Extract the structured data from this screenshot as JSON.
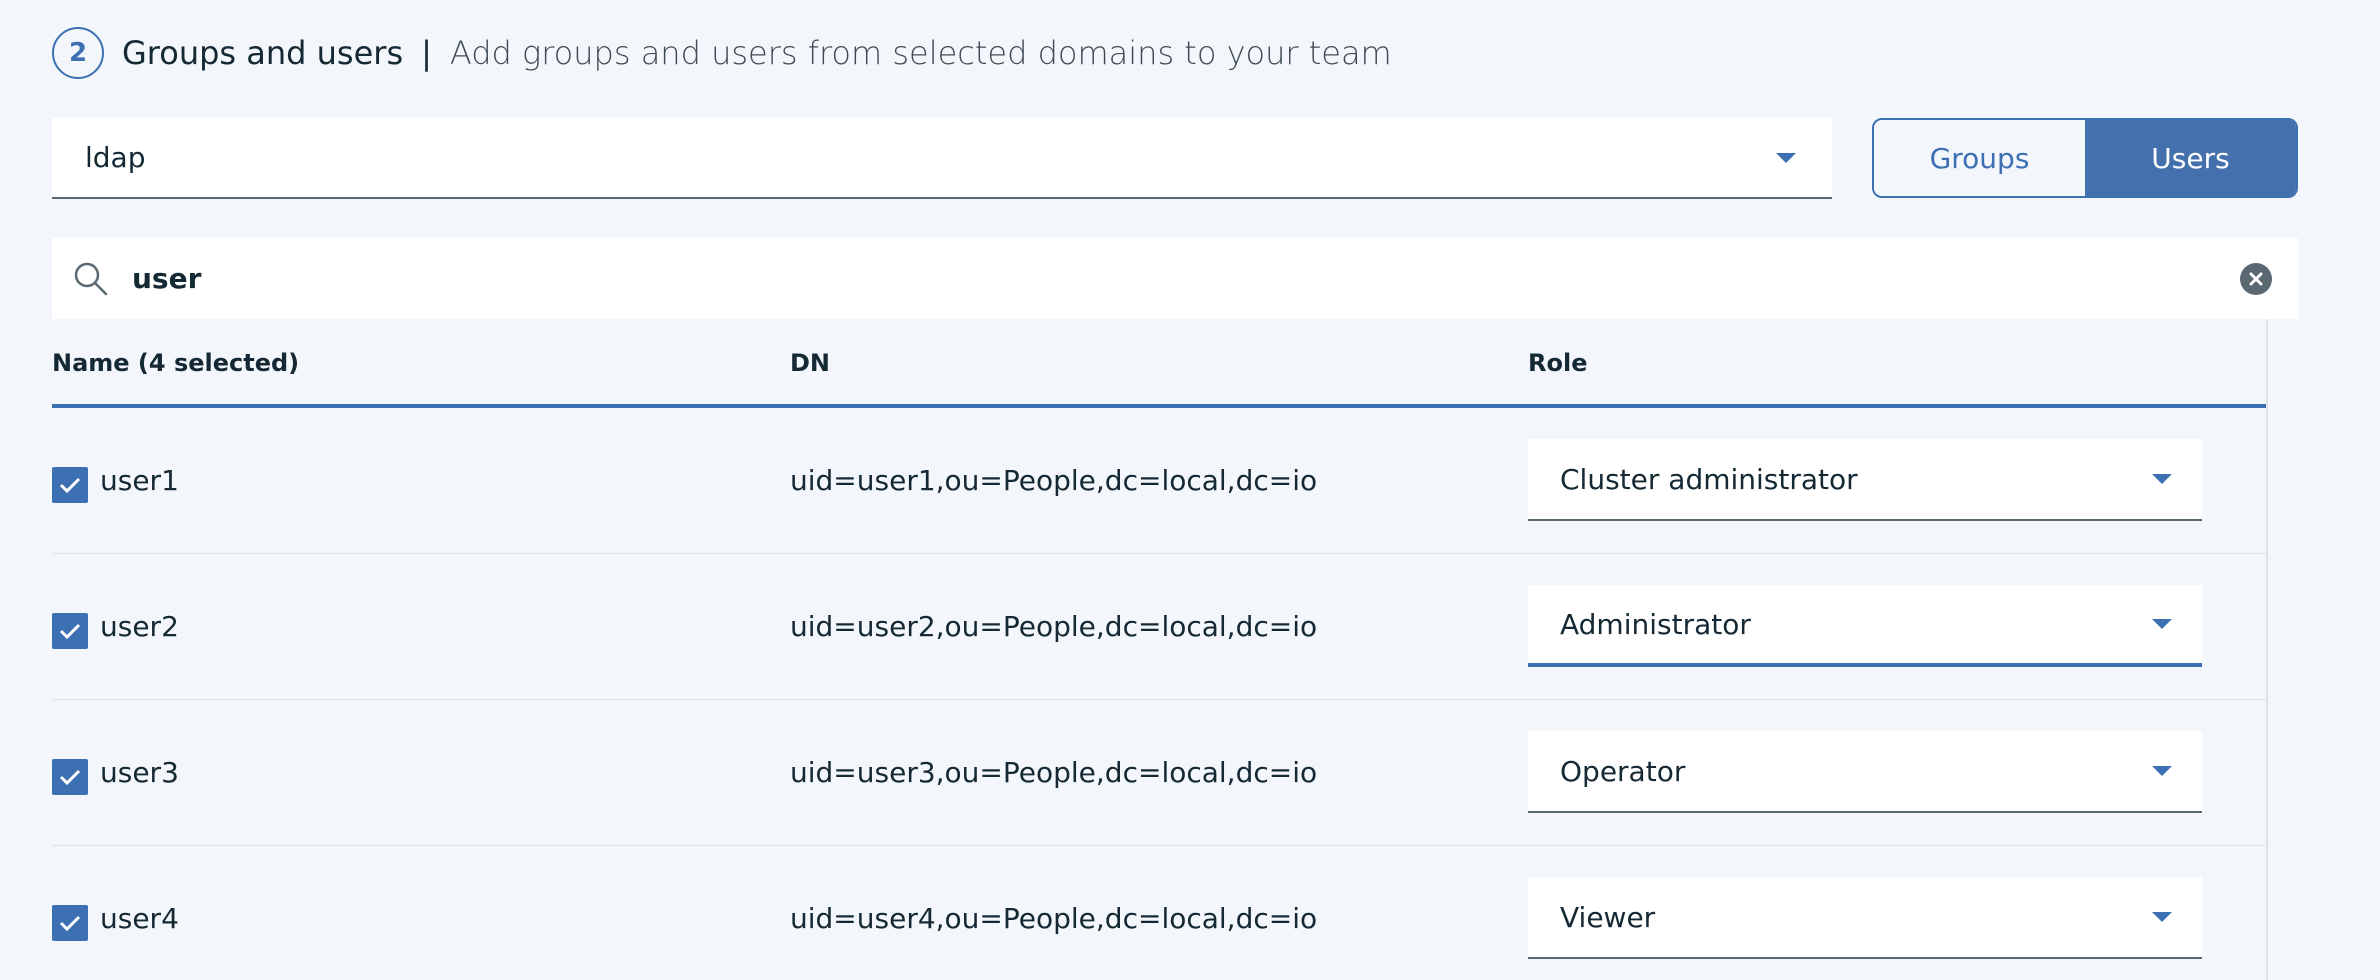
{
  "header": {
    "step_number": "2",
    "title": "Groups and users",
    "separator": "|",
    "description": "Add groups and users from selected domains to your team"
  },
  "domain_select": {
    "value": "ldap"
  },
  "toggle": {
    "groups_label": "Groups",
    "users_label": "Users",
    "selected": "Users"
  },
  "search": {
    "value": "user"
  },
  "table": {
    "columns": {
      "name": "Name (4 selected)",
      "dn": "DN",
      "role": "Role"
    },
    "rows": [
      {
        "name": "user1",
        "dn": "uid=user1,ou=People,dc=local,dc=io",
        "role": "Cluster administrator",
        "checked": true
      },
      {
        "name": "user2",
        "dn": "uid=user2,ou=People,dc=local,dc=io",
        "role": "Administrator",
        "checked": true
      },
      {
        "name": "user3",
        "dn": "uid=user3,ou=People,dc=local,dc=io",
        "role": "Operator",
        "checked": true
      },
      {
        "name": "user4",
        "dn": "uid=user4,ou=People,dc=local,dc=io",
        "role": "Viewer",
        "checked": true
      }
    ]
  },
  "colors": {
    "accent": "#3d70b2",
    "toggle_active": "#4471ad",
    "background": "#f3f6fa"
  }
}
